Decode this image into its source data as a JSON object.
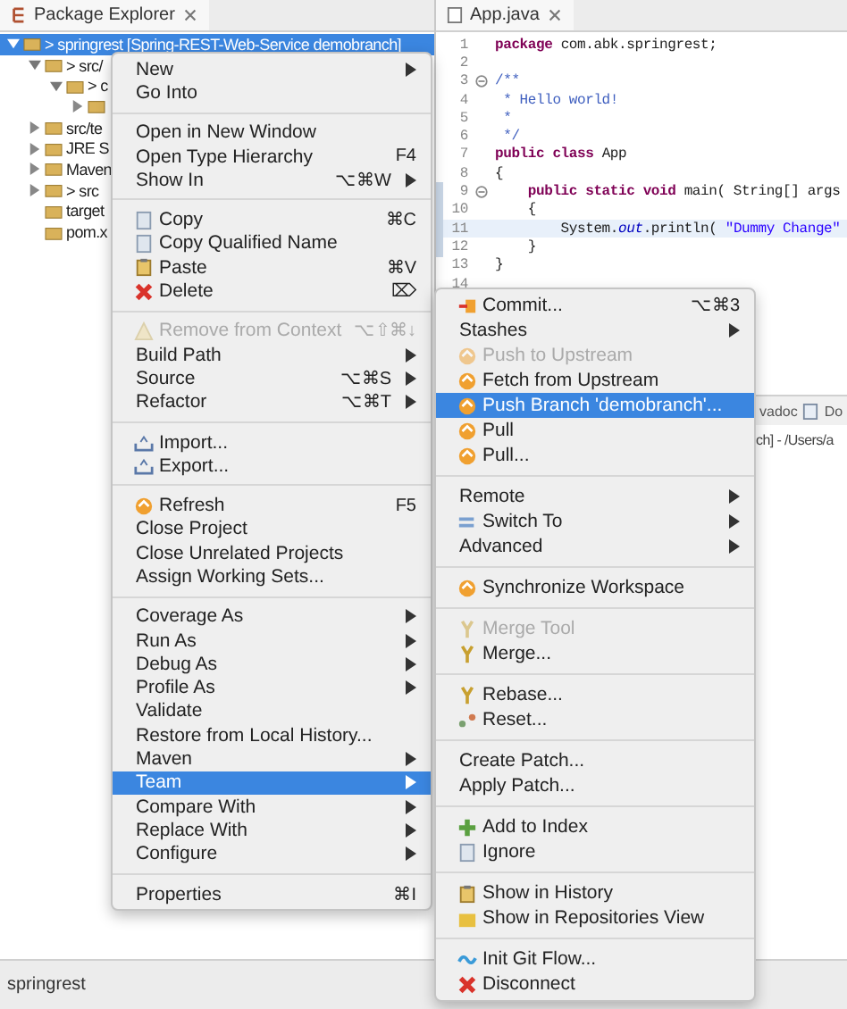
{
  "explorer": {
    "title": "Package Explorer",
    "tree": [
      {
        "label": "> springrest [Spring-REST-Web-Service demobranch]",
        "expanded": true,
        "selected": true,
        "children": [
          {
            "label": "> src/",
            "expanded": true,
            "selected": false,
            "children": [
              {
                "label": "> c",
                "expanded": true,
                "selected": false,
                "children": [
                  {
                    "expanded": false,
                    "selected": false
                  }
                ]
              }
            ]
          },
          {
            "label": "src/te",
            "expanded": false,
            "selected": false
          },
          {
            "label": "JRE S",
            "expanded": false,
            "selected": false
          },
          {
            "label": "Maven",
            "expanded": false,
            "selected": false
          },
          {
            "label": "> src",
            "expanded": false,
            "selected": false
          },
          {
            "label": "target",
            "selected": false
          },
          {
            "label": "pom.x",
            "selected": false
          }
        ]
      }
    ]
  },
  "editor": {
    "tab": "App.java",
    "lines": [
      {
        "number": "1",
        "tokens": [
          {
            "kind": "keyword",
            "text": "package"
          },
          {
            "kind": "plain",
            "text": " com.abk.springrest;"
          }
        ]
      },
      {
        "number": "2"
      },
      {
        "number": "3",
        "fold": true,
        "tokens": [
          {
            "kind": "comment",
            "text": "/**"
          }
        ]
      },
      {
        "number": "4",
        "tokens": [
          {
            "kind": "comment",
            "text": " * Hello world!"
          }
        ]
      },
      {
        "number": "5",
        "tokens": [
          {
            "kind": "comment",
            "text": " *"
          }
        ]
      },
      {
        "number": "6",
        "tokens": [
          {
            "kind": "comment",
            "text": " */"
          }
        ]
      },
      {
        "number": "7",
        "tokens": [
          {
            "kind": "keyword",
            "text": "public class"
          },
          {
            "kind": "plain",
            "text": " App"
          }
        ]
      },
      {
        "number": "8",
        "tokens": [
          {
            "kind": "plain",
            "text": "{"
          }
        ]
      },
      {
        "number": "9",
        "fold": true,
        "tokens": [
          {
            "kind": "keyword",
            "text": "    public static void"
          },
          {
            "kind": "plain",
            "text": " main( String[] args"
          }
        ]
      },
      {
        "number": "10",
        "tokens": [
          {
            "kind": "plain",
            "text": "    {"
          }
        ]
      },
      {
        "number": "11",
        "current": true,
        "tokens": [
          {
            "kind": "plain",
            "text": "        System."
          },
          {
            "kind": "field",
            "text": "out"
          },
          {
            "kind": "plain",
            "text": ".println( "
          },
          {
            "kind": "string",
            "text": "\"Dummy Change\""
          }
        ]
      },
      {
        "number": "12",
        "tokens": [
          {
            "kind": "plain",
            "text": "    }"
          }
        ]
      },
      {
        "number": "13",
        "tokens": [
          {
            "kind": "plain",
            "text": "}"
          }
        ]
      },
      {
        "number": "14"
      }
    ]
  },
  "bottom_view": {
    "tabs": [
      "vadoc",
      "Do"
    ],
    "path": "ch] - /Users/a"
  },
  "context_menu": {
    "sections": [
      [
        {
          "label": "New",
          "submenu": true,
          "disabled": false,
          "selected": false
        },
        {
          "label": "Go Into",
          "submenu": false,
          "disabled": false,
          "selected": false
        }
      ],
      [
        {
          "label": "Open in New Window",
          "submenu": false,
          "disabled": false,
          "selected": false
        },
        {
          "label": "Open Type Hierarchy",
          "shortcut": "F4",
          "submenu": false,
          "disabled": false,
          "selected": false
        },
        {
          "label": "Show In",
          "shortcut": "⌥⌘W",
          "submenu": true,
          "disabled": false,
          "selected": false
        }
      ],
      [
        {
          "label": "Copy",
          "shortcut": "⌘C",
          "submenu": false,
          "disabled": false,
          "selected": false
        },
        {
          "label": "Copy Qualified Name",
          "submenu": false,
          "disabled": false,
          "selected": false
        },
        {
          "label": "Paste",
          "shortcut": "⌘V",
          "submenu": false,
          "disabled": false,
          "selected": false
        },
        {
          "label": "Delete",
          "shortcut": "⌦",
          "submenu": false,
          "disabled": false,
          "selected": false
        }
      ],
      [
        {
          "label": "Remove from Context",
          "shortcut": "⌥⇧⌘↓",
          "submenu": false,
          "disabled": true,
          "selected": false
        },
        {
          "label": "Build Path",
          "submenu": true,
          "disabled": false,
          "selected": false
        },
        {
          "label": "Source",
          "shortcut": "⌥⌘S",
          "submenu": true,
          "disabled": false,
          "selected": false
        },
        {
          "label": "Refactor",
          "shortcut": "⌥⌘T",
          "submenu": true,
          "disabled": false,
          "selected": false
        }
      ],
      [
        {
          "label": "Import...",
          "submenu": false,
          "disabled": false,
          "selected": false
        },
        {
          "label": "Export...",
          "submenu": false,
          "disabled": false,
          "selected": false
        }
      ],
      [
        {
          "label": "Refresh",
          "shortcut": "F5",
          "submenu": false,
          "disabled": false,
          "selected": false
        },
        {
          "label": "Close Project",
          "submenu": false,
          "disabled": false,
          "selected": false
        },
        {
          "label": "Close Unrelated Projects",
          "submenu": false,
          "disabled": false,
          "selected": false
        },
        {
          "label": "Assign Working Sets...",
          "submenu": false,
          "disabled": false,
          "selected": false
        }
      ],
      [
        {
          "label": "Coverage As",
          "submenu": true,
          "disabled": false,
          "selected": false
        },
        {
          "label": "Run As",
          "submenu": true,
          "disabled": false,
          "selected": false
        },
        {
          "label": "Debug As",
          "submenu": true,
          "disabled": false,
          "selected": false
        },
        {
          "label": "Profile As",
          "submenu": true,
          "disabled": false,
          "selected": false
        },
        {
          "label": "Validate",
          "submenu": false,
          "disabled": false,
          "selected": false
        },
        {
          "label": "Restore from Local History...",
          "submenu": false,
          "disabled": false,
          "selected": false
        },
        {
          "label": "Maven",
          "submenu": true,
          "disabled": false,
          "selected": false
        },
        {
          "label": "Team",
          "submenu": true,
          "disabled": false,
          "selected": true
        },
        {
          "label": "Compare With",
          "submenu": true,
          "disabled": false,
          "selected": false
        },
        {
          "label": "Replace With",
          "submenu": true,
          "disabled": false,
          "selected": false
        },
        {
          "label": "Configure",
          "submenu": true,
          "disabled": false,
          "selected": false
        }
      ],
      [
        {
          "label": "Properties",
          "shortcut": "⌘I",
          "submenu": false,
          "disabled": false,
          "selected": false
        }
      ]
    ]
  },
  "team_submenu": {
    "sections": [
      [
        {
          "label": "Commit...",
          "shortcut": "⌥⌘3",
          "submenu": false,
          "disabled": false,
          "selected": false
        },
        {
          "label": "Stashes",
          "submenu": true,
          "disabled": false,
          "selected": false
        },
        {
          "label": "Push to Upstream",
          "submenu": false,
          "disabled": true,
          "selected": false
        },
        {
          "label": "Fetch from Upstream",
          "submenu": false,
          "disabled": false,
          "selected": false
        },
        {
          "label": "Push Branch 'demobranch'...",
          "submenu": false,
          "disabled": false,
          "selected": true
        },
        {
          "label": "Pull",
          "submenu": false,
          "disabled": false,
          "selected": false
        },
        {
          "label": "Pull...",
          "submenu": false,
          "disabled": false,
          "selected": false
        }
      ],
      [
        {
          "label": "Remote",
          "submenu": true,
          "disabled": false,
          "selected": false
        },
        {
          "label": "Switch To",
          "submenu": true,
          "disabled": false,
          "selected": false
        },
        {
          "label": "Advanced",
          "submenu": true,
          "disabled": false,
          "selected": false
        }
      ],
      [
        {
          "label": "Synchronize Workspace",
          "submenu": false,
          "disabled": false,
          "selected": false
        }
      ],
      [
        {
          "label": "Merge Tool",
          "submenu": false,
          "disabled": true,
          "selected": false
        },
        {
          "label": "Merge...",
          "submenu": false,
          "disabled": false,
          "selected": false
        }
      ],
      [
        {
          "label": "Rebase...",
          "submenu": false,
          "disabled": false,
          "selected": false
        },
        {
          "label": "Reset...",
          "submenu": false,
          "disabled": false,
          "selected": false
        }
      ],
      [
        {
          "label": "Create Patch...",
          "submenu": false,
          "disabled": false,
          "selected": false
        },
        {
          "label": "Apply Patch...",
          "submenu": false,
          "disabled": false,
          "selected": false
        }
      ],
      [
        {
          "label": "Add to Index",
          "submenu": false,
          "disabled": false,
          "selected": false
        },
        {
          "label": "Ignore",
          "submenu": false,
          "disabled": false,
          "selected": false
        }
      ],
      [
        {
          "label": "Show in History",
          "submenu": false,
          "disabled": false,
          "selected": false
        },
        {
          "label": "Show in Repositories View",
          "submenu": false,
          "disabled": false,
          "selected": false
        }
      ],
      [
        {
          "label": "Init Git Flow...",
          "submenu": false,
          "disabled": false,
          "selected": false
        },
        {
          "label": "Disconnect",
          "submenu": false,
          "disabled": false,
          "selected": false
        }
      ]
    ]
  },
  "status_bar": {
    "text": "springrest"
  }
}
